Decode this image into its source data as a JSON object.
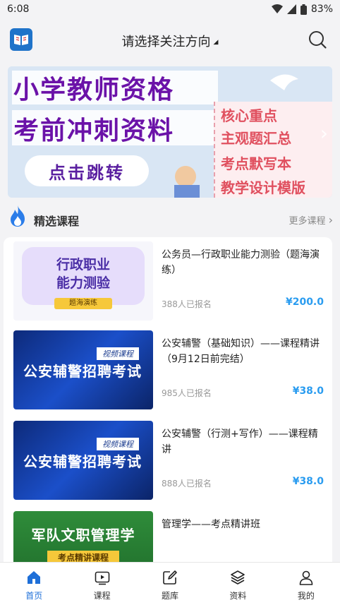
{
  "status": {
    "time": "6:08",
    "battery": "83%"
  },
  "header": {
    "title": "请选择关注方向"
  },
  "banner": {
    "headline_1": "小学教师资格",
    "headline_2": "考前冲刺资料",
    "button": "点击跳转",
    "tags": [
      "核心重点",
      "主观题汇总",
      "考点默写本",
      "教学设计模版"
    ]
  },
  "section": {
    "title": "精选课程",
    "more": "更多课程"
  },
  "courses": [
    {
      "thumb": {
        "line1": "行政职业",
        "line2": "能力测验",
        "tag": "题海演练"
      },
      "title": "公务员—行政职业能力测验（题海演练）",
      "count": "388人已报名",
      "price": "¥200.0"
    },
    {
      "thumb": {
        "video": "视频课程",
        "big": "公安辅警招聘考试"
      },
      "title": "公安辅警（基础知识）——课程精讲（9月12日前完结）",
      "count": "985人已报名",
      "price": "¥38.0"
    },
    {
      "thumb": {
        "video": "视频课程",
        "big": "公安辅警招聘考试"
      },
      "title": "公安辅警（行测+写作）——课程精讲",
      "count": "888人已报名",
      "price": "¥38.0"
    },
    {
      "thumb": {
        "big": "军队文职管理学",
        "tag": "考点精讲课程"
      },
      "title": "管理学——考点精讲班"
    }
  ],
  "tabs": [
    {
      "label": "首页",
      "icon": "home-icon",
      "active": true
    },
    {
      "label": "课程",
      "icon": "video-icon"
    },
    {
      "label": "题库",
      "icon": "edit-icon"
    },
    {
      "label": "资料",
      "icon": "layers-icon"
    },
    {
      "label": "我的",
      "icon": "user-icon"
    }
  ],
  "colors": {
    "accent": "#1e6fd8",
    "price": "#2a9cf0",
    "banner_text": "#6b12a8",
    "tag_red": "#e0505f"
  }
}
